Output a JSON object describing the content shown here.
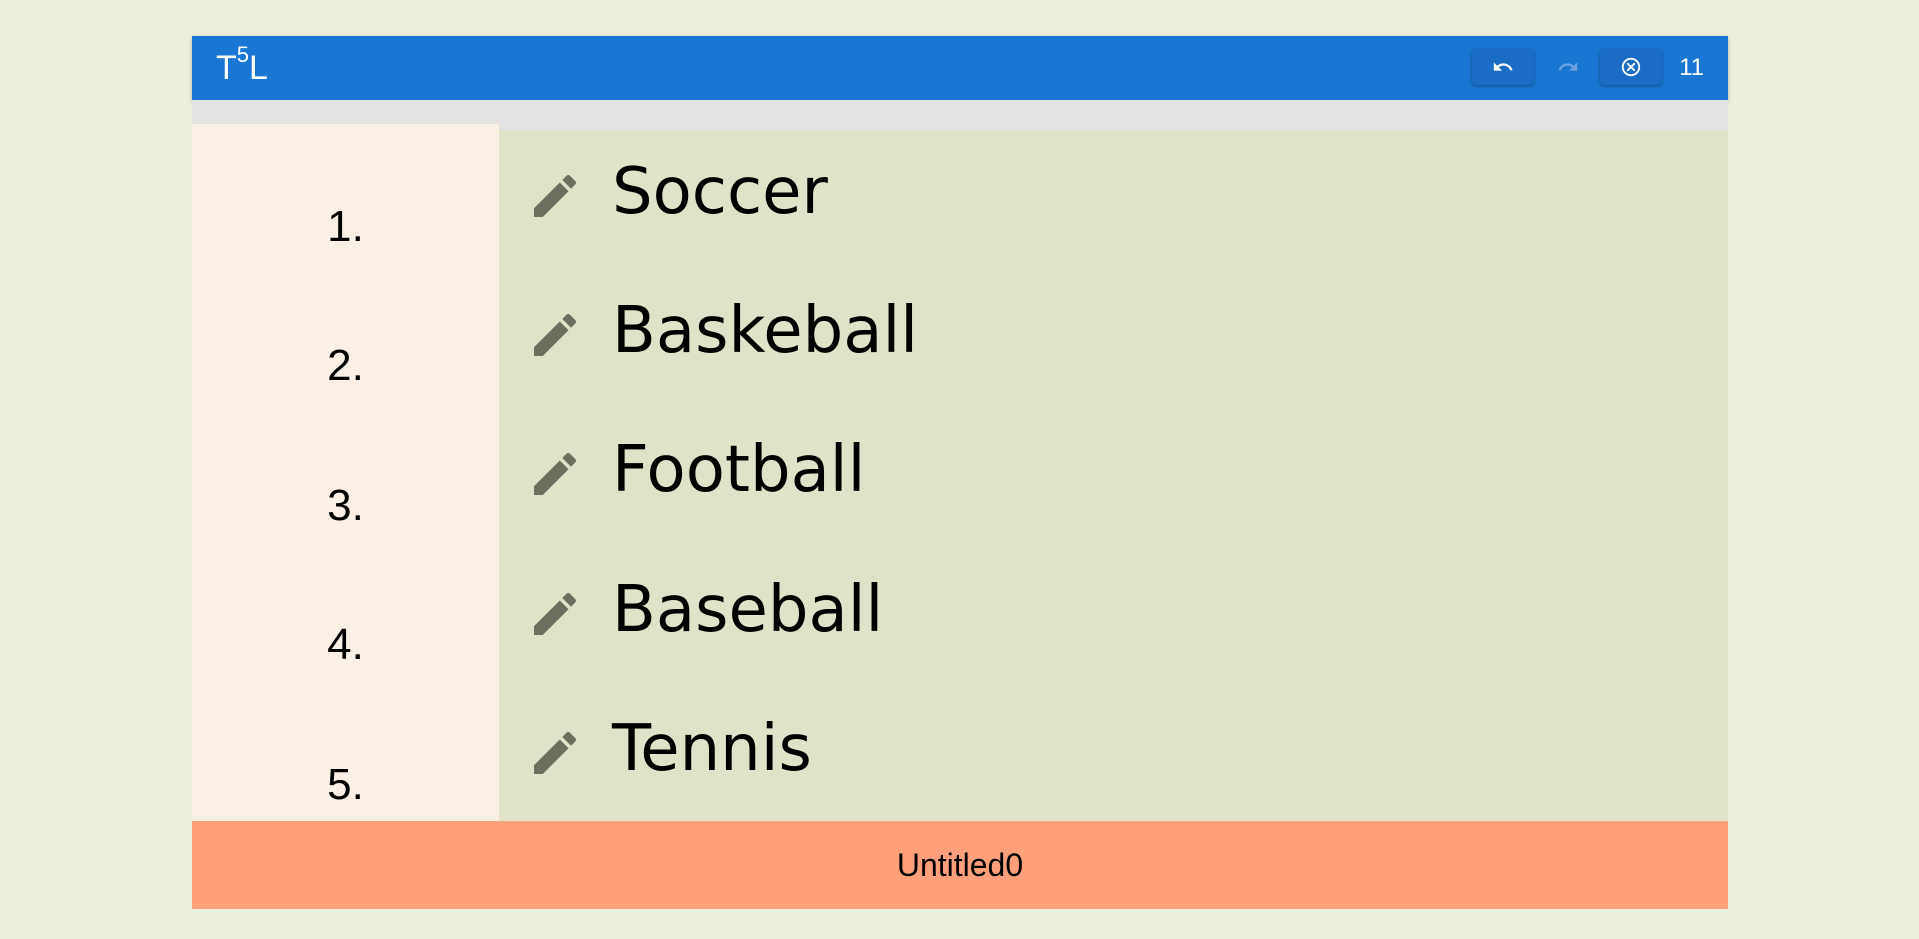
{
  "header": {
    "logo_main": "T",
    "logo_sup": "5",
    "logo_end": "L",
    "undo_icon": "undo-icon",
    "redo_icon": "redo-icon",
    "clear_icon": "cancel-circle-icon",
    "counter": "11",
    "colors": {
      "bar": "#1976d2"
    }
  },
  "list": {
    "numbers": [
      "1.",
      "2.",
      "3.",
      "4.",
      "5."
    ],
    "items": [
      {
        "label": "Soccer",
        "icon": "pencil-icon"
      },
      {
        "label": "Baskeball",
        "icon": "pencil-icon"
      },
      {
        "label": "Football",
        "icon": "pencil-icon"
      },
      {
        "label": "Baseball",
        "icon": "pencil-icon"
      },
      {
        "label": "Tennis",
        "icon": "pencil-icon"
      }
    ],
    "colors": {
      "numbers_bg": "#faf0e6",
      "items_bg": "#e1e3c9",
      "pencil": "#6b6f5e"
    }
  },
  "footer": {
    "title": "Untitled0",
    "color": "#ffa07a"
  }
}
